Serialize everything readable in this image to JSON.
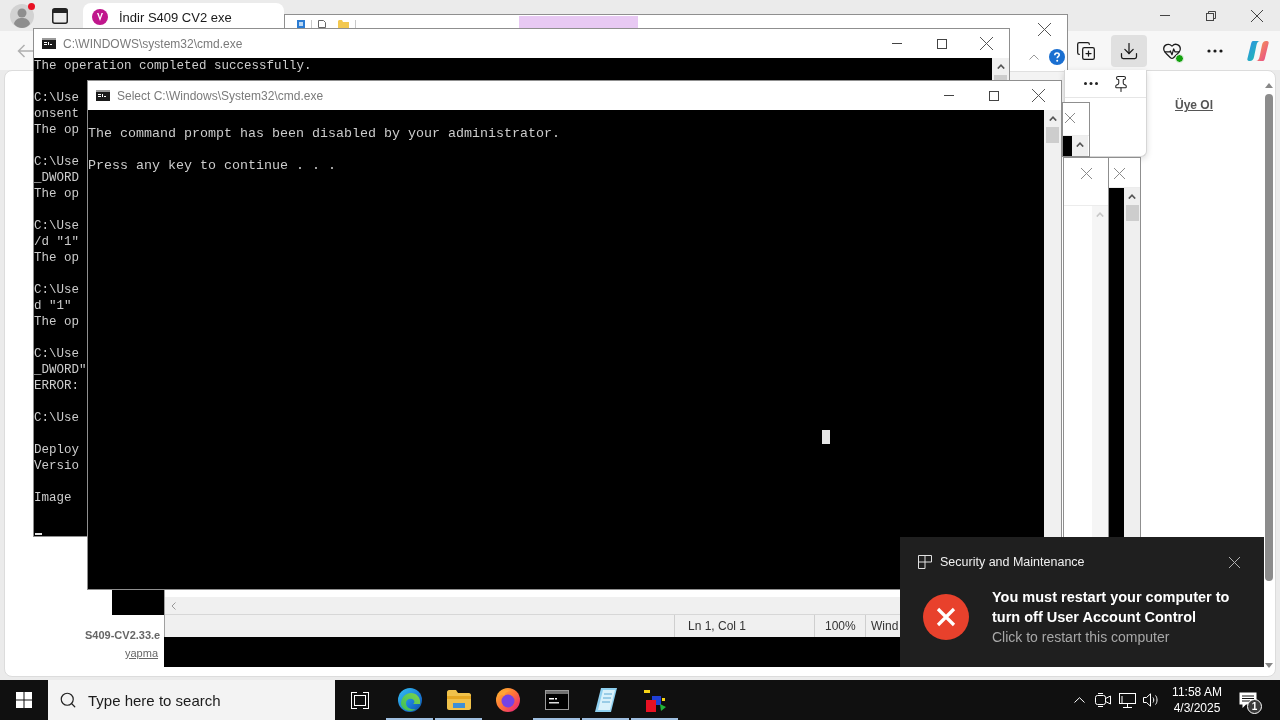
{
  "browser": {
    "profile": {
      "alert": true
    },
    "tab": {
      "title": "İndir S409 CV2 exe"
    },
    "toolbar": [
      {
        "kind": "collections",
        "selected": false
      },
      {
        "kind": "downloads",
        "selected": true
      },
      {
        "kind": "health",
        "selected": false
      },
      {
        "kind": "more",
        "selected": false
      },
      {
        "kind": "assistant",
        "selected": false
      }
    ],
    "page": {
      "signup_link": "Üye Ol",
      "file_name": "S409-CV2.33.e",
      "file_link": "yapma"
    }
  },
  "cmd_windows": [
    {
      "title": "C:\\WINDOWS\\system32\\cmd.exe",
      "blocks": [
        [
          "The operation completed successfully."
        ],
        [
          "C:\\Use",
          "onsent",
          "The op"
        ],
        [
          "C:\\Use",
          "_DWORD",
          "The op"
        ],
        [
          "C:\\Use",
          "/d \"1\"",
          "The op"
        ],
        [
          "C:\\Use",
          "d \"1\"",
          "The op"
        ],
        [
          "C:\\Use",
          "_DWORD\"",
          "ERROR:"
        ],
        [
          "C:\\Use"
        ],
        [
          "Deploy",
          "Versio"
        ],
        [
          "Image"
        ]
      ]
    },
    {
      "title": "Select C:\\Windows\\System32\\cmd.exe",
      "blocks": [
        [
          "The command prompt has been disabled by your administrator."
        ],
        [
          "Press any key to continue . . ."
        ]
      ]
    }
  ],
  "notepad": {
    "status": [
      "Ln 1, Col 1",
      "100%",
      "Wind"
    ]
  },
  "toast": {
    "source": "Security and Maintenance",
    "title": "You must restart your computer to turn off User Account Control",
    "body": "Click to restart this computer"
  },
  "taskbar": {
    "search": {
      "placeholder": "Type here to search"
    },
    "apps": [
      {
        "kind": "swirl",
        "running": true
      },
      {
        "kind": "folder",
        "running": true
      },
      {
        "kind": "globe",
        "running": false
      },
      {
        "kind": "terminal",
        "running": true
      },
      {
        "kind": "notepad",
        "running": true
      },
      {
        "kind": "shapes",
        "running": true
      }
    ],
    "time": "11:58 AM",
    "date": "4/3/2025",
    "notification_count": "1"
  }
}
